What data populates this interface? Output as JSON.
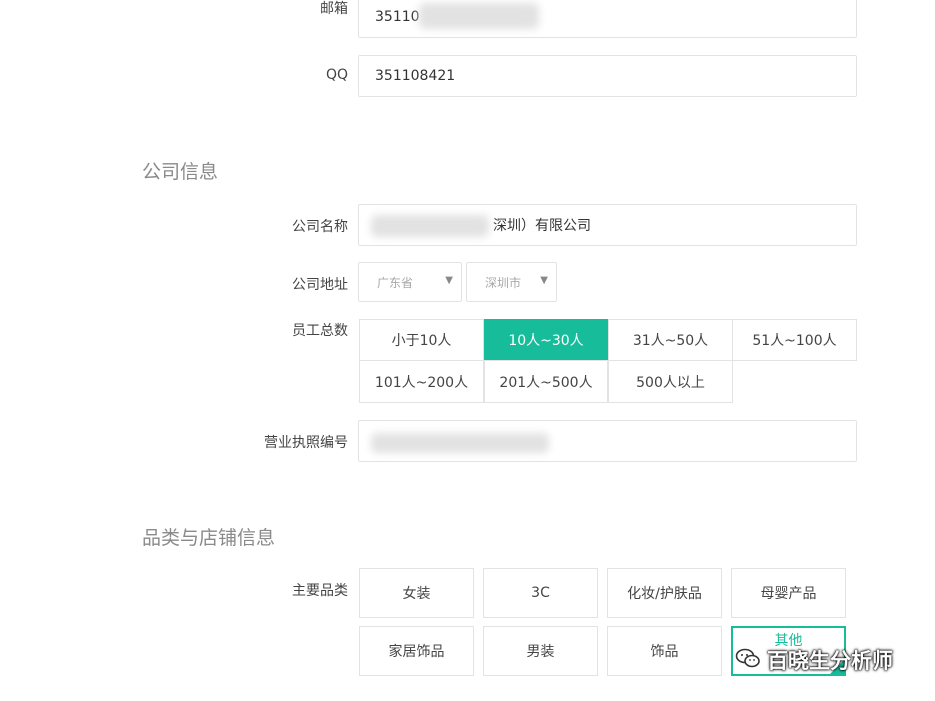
{
  "contact": {
    "email_label": "邮箱",
    "email_value": "35110",
    "qq_label": "QQ",
    "qq_value": "351108421"
  },
  "company": {
    "section_title": "公司信息",
    "name_label": "公司名称",
    "name_value_visible": "深圳）有限公司",
    "address_label": "公司地址",
    "province": "广东省",
    "city": "深圳市",
    "staff_label": "员工总数",
    "staff_options": [
      "小于10人",
      "10人~30人",
      "31人~50人",
      "51人~100人",
      "101人~200人",
      "201人~500人",
      "500人以上"
    ],
    "staff_selected": "10人~30人",
    "license_label": "营业执照编号"
  },
  "category": {
    "section_title": "品类与店铺信息",
    "main_label": "主要品类",
    "options": [
      "女装",
      "3C",
      "化妆/护肤品",
      "母婴产品",
      "家居饰品",
      "男装",
      "饰品",
      "其他"
    ],
    "selected": "其他"
  },
  "watermark": {
    "text": "百晓生分析师",
    "icon": "wechat-icon"
  },
  "colors": {
    "accent": "#17bc9b"
  }
}
